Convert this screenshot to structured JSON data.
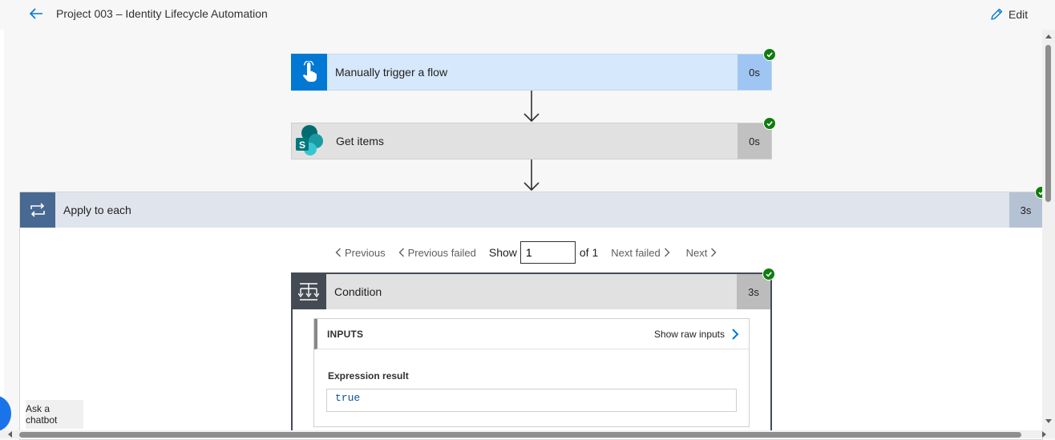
{
  "header": {
    "title": "Project 003 – Identity Lifecycle Automation",
    "edit_label": "Edit",
    "back_icon": "arrow-left-icon",
    "edit_icon": "pencil-icon"
  },
  "flow": {
    "trigger": {
      "label": "Manually trigger a flow",
      "duration": "0s",
      "icon": "touch-hand-icon",
      "status": "succeeded"
    },
    "get_items": {
      "label": "Get items",
      "duration": "0s",
      "icon": "sharepoint-icon",
      "status": "succeeded"
    },
    "apply_to_each": {
      "label": "Apply to each",
      "duration": "3s",
      "icon": "loop-icon",
      "status": "succeeded"
    }
  },
  "pager": {
    "previous": "Previous",
    "previous_failed": "Previous failed",
    "show": "Show",
    "current": "1",
    "of": "of 1",
    "next_failed": "Next failed",
    "next": "Next"
  },
  "condition": {
    "label": "Condition",
    "duration": "3s",
    "icon": "condition-icon",
    "status": "succeeded",
    "inputs": {
      "title": "INPUTS",
      "show_raw": "Show raw inputs",
      "expression_label": "Expression result",
      "expression_value": "true"
    }
  },
  "chatbot": {
    "label": "Ask a chatbot"
  },
  "colors": {
    "accent": "#0078d4",
    "success": "#107c10",
    "loop": "#486991",
    "condition": "#444b55"
  }
}
